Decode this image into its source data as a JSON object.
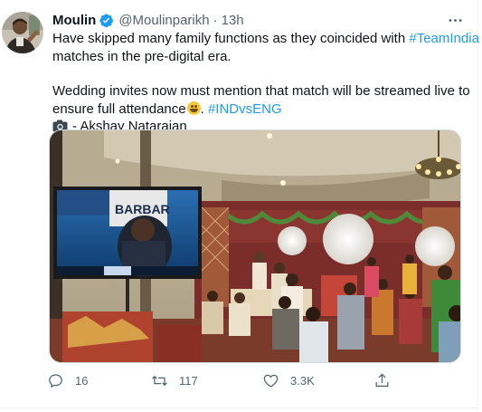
{
  "tweet": {
    "author_name": "Moulin",
    "handle": "@Moulinparikh",
    "separator": "·",
    "time": "13h",
    "verified": true,
    "text": {
      "p1_a": "Have skipped many family functions as they coincided with ",
      "p1_tag": "#TeamIndia",
      "p1_b": "matches in the pre-digital era.",
      "p2_a": "Wedding invites now must mention that match will be streamed live to",
      "p2_b": "ensure full attendance",
      "p2_sep": ". ",
      "p2_tag": "#INDvsENG",
      "credit": "- Akshay Natarajan"
    },
    "media": {
      "tv_banner": "BARBAR",
      "tv_sub": "BAR"
    },
    "actions": {
      "reply_count": "16",
      "retweet_count": "117",
      "like_count": "3.3K"
    }
  },
  "colors": {
    "accent": "#1d9bf0",
    "text": "#0f1419",
    "muted": "#536471",
    "verified": "#1d9bf0"
  },
  "icons": {
    "more": "more-dots-icon",
    "verified": "verified-badge-icon",
    "camera": "camera-icon",
    "reply": "reply-icon",
    "retweet": "retweet-icon",
    "like": "heart-icon",
    "share": "share-icon"
  }
}
